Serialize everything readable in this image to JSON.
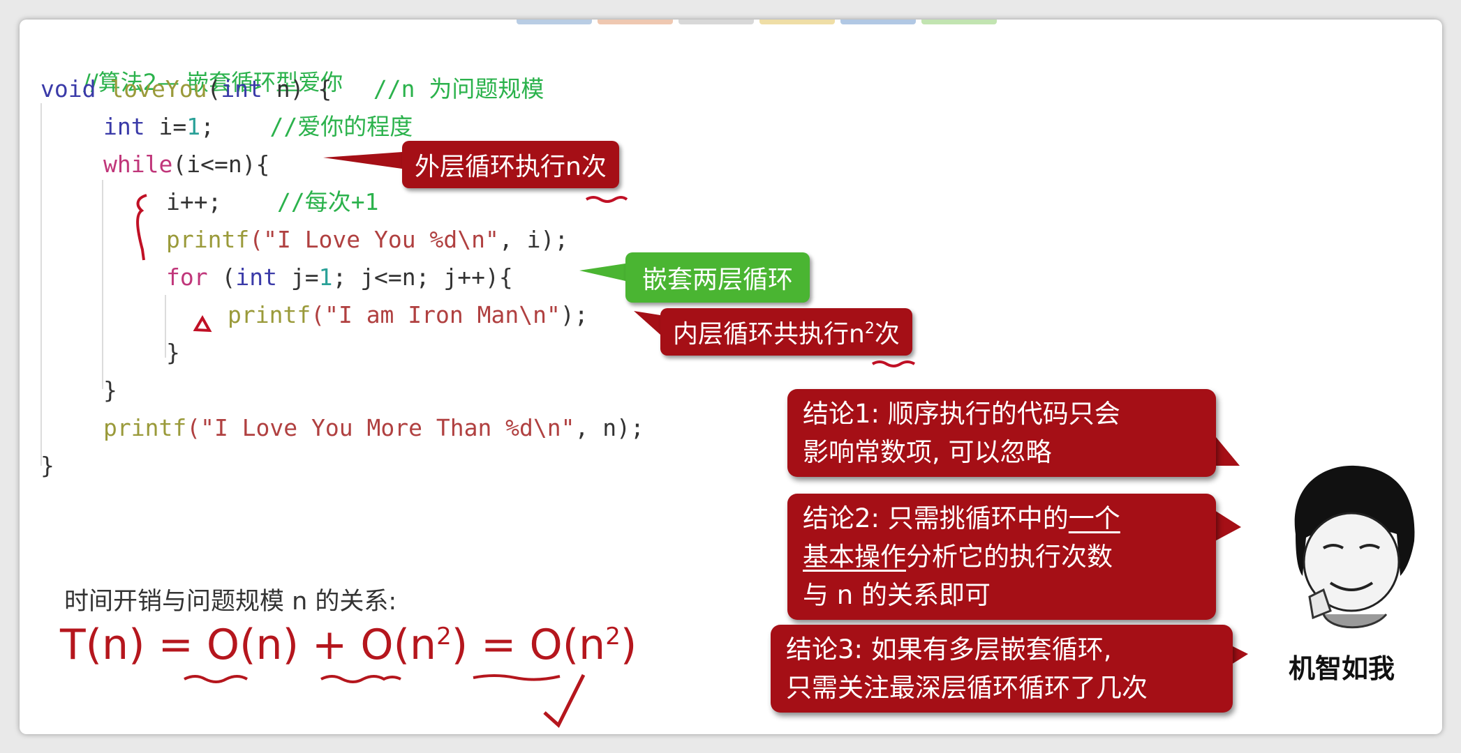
{
  "tab_colors": [
    "#9bb8d8",
    "#e8b090",
    "#c8c8c8",
    "#e8d080",
    "#90b0d8",
    "#a8d890"
  ],
  "code": {
    "comment_title": "//算法2— 嵌套循环型爱你",
    "l1_void": "void",
    "l1_fn": "loveYou",
    "l1_paren": "(",
    "l1_int": "int",
    "l1_rest": " n) {",
    "l1_comment": "//n 为问题规模",
    "l2_int": "int",
    "l2_i": " i=",
    "l2_num": "1",
    "l2_semi": ";",
    "l2_comment": "//爱你的程度",
    "l3_while": "while",
    "l3_rest": "(i<=n){",
    "l4_code": "i++;",
    "l4_comment": "//每次+1",
    "l5_fn": "printf",
    "l5_str": "(\"I Love You %d\\n\"",
    "l5_rest": ", i);",
    "l6_for": "for",
    "l6_rest1": " (",
    "l6_int": "int",
    "l6_rest2": " j=",
    "l6_num": "1",
    "l6_rest3": "; j<=n; j++){",
    "l7_fn": "printf",
    "l7_str": "(\"I am Iron Man\\n\"",
    "l7_rest": ");",
    "l8": "}",
    "l9": "}",
    "l10_fn": "printf",
    "l10_str": "(\"I Love You More Than %d\\n\"",
    "l10_rest": ", n);",
    "l11": "}"
  },
  "callouts": {
    "outer_loop": "外层循环执行n次",
    "nested": "嵌套两层循环",
    "inner_loop_prefix": "内层循环共执行n",
    "inner_loop_sup": "2",
    "inner_loop_suffix": "次"
  },
  "relation": {
    "label": "时间开销与问题规模 n 的关系:",
    "formula_a": "T(n) = O(n) + O(n",
    "formula_sup1": "2",
    "formula_b": ") = O(n",
    "formula_sup2": "2",
    "formula_c": ")"
  },
  "conclusions": {
    "c1_line1": "结论1: 顺序执行的代码只会",
    "c1_line2": "影响常数项, 可以忽略",
    "c2_line1_a": "结论2: 只需挑循环中的",
    "c2_line1_b": "一个",
    "c2_line2_a": "基本操作",
    "c2_line2_b": "分析它的执行次数",
    "c2_line3": "与 n 的关系即可",
    "c3_line1": "结论3: 如果有多层嵌套循环,",
    "c3_line2": "只需关注最深层循环循环了几次"
  },
  "meme": {
    "caption": "机智如我"
  }
}
